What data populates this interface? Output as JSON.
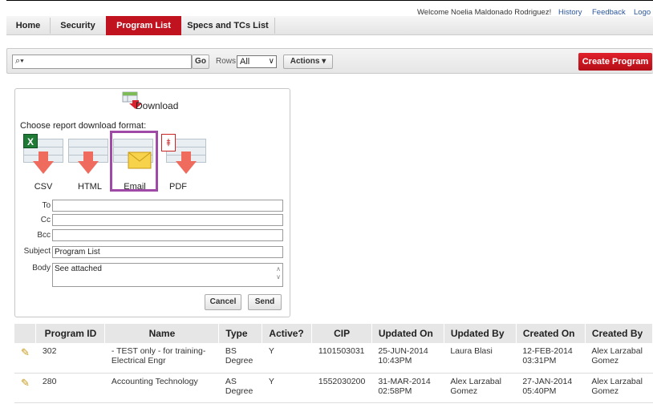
{
  "header": {
    "welcome": "Welcome Noelia Maldonado Rodriguez!",
    "links": [
      "History",
      "Feedback",
      "Logo"
    ]
  },
  "tabs": [
    {
      "label": "Home",
      "active": false
    },
    {
      "label": "Security",
      "active": false
    },
    {
      "label": "Program List",
      "active": true
    },
    {
      "label": "Specs and TCs List",
      "active": false
    }
  ],
  "toolbar": {
    "search_value": "",
    "go_label": "Go",
    "rows_label": "Rows",
    "rows_value": "All",
    "actions_label": "Actions ▾",
    "create_label": "Create Program"
  },
  "download": {
    "title": "Download",
    "choose": "Choose report download format:",
    "formats": [
      "CSV",
      "HTML",
      "Email",
      "PDF"
    ],
    "selected": "Email",
    "fields": {
      "to_label": "To",
      "to_value": "",
      "cc_label": "Cc",
      "cc_value": "",
      "bcc_label": "Bcc",
      "bcc_value": "",
      "subject_label": "Subject",
      "subject_value": "Program List",
      "body_label": "Body",
      "body_value": "See attached"
    },
    "cancel_label": "Cancel",
    "send_label": "Send"
  },
  "table": {
    "columns": [
      "Program ID",
      "Name",
      "Type",
      "Active?",
      "CIP",
      "Updated On",
      "Updated By",
      "Created On",
      "Created By"
    ],
    "rows": [
      {
        "id": "302",
        "name": "- TEST only - for training-\nElectrical Engr",
        "type": "BS\nDegree",
        "active": "Y",
        "cip": "1101503031",
        "updated_on": "25-JUN-2014\n10:43PM",
        "updated_by": "Laura Blasi",
        "created_on": "12-FEB-2014\n03:31PM",
        "created_by": "Alex Larzabal\nGomez"
      },
      {
        "id": "280",
        "name": "Accounting Technology",
        "type": "AS\nDegree",
        "active": "Y",
        "cip": "1552030200",
        "updated_on": "31-MAR-2014\n02:58PM",
        "updated_by": "Alex Larzabal\nGomez",
        "created_on": "27-JAN-2014\n05:40PM",
        "created_by": "Alex Larzabal\nGomez"
      }
    ]
  },
  "colors": {
    "accent": "#c1121f",
    "highlight": "#a04aa8"
  }
}
